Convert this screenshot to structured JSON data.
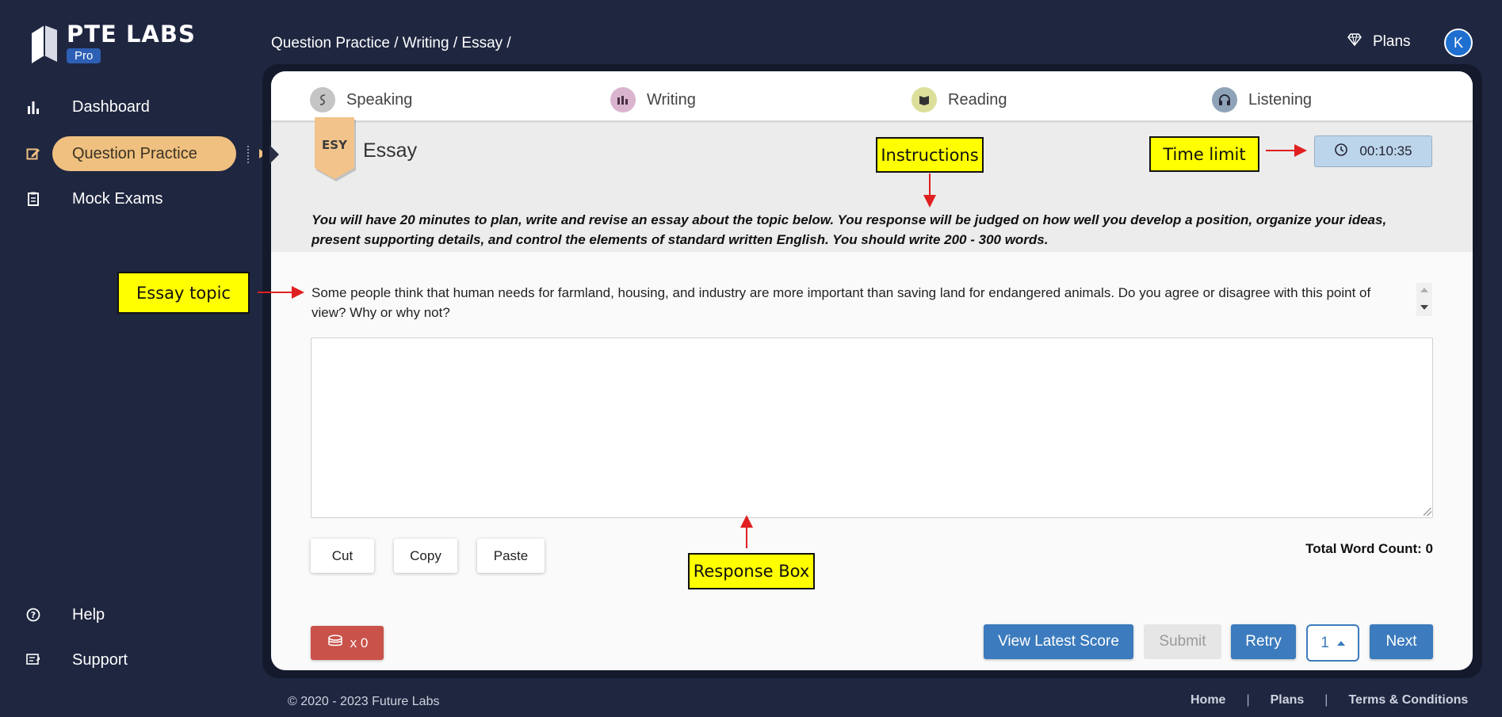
{
  "brand": {
    "title": "PTE LABS",
    "badge": "Pro"
  },
  "sidebar": {
    "items": [
      {
        "label": "Dashboard",
        "icon": "bar-chart-icon"
      },
      {
        "label": "Question Practice",
        "icon": "edit-icon",
        "active": true
      },
      {
        "label": "Mock Exams",
        "icon": "clipboard-icon"
      }
    ],
    "bottom_items": [
      {
        "label": "Help",
        "icon": "help-icon"
      },
      {
        "label": "Support",
        "icon": "support-icon"
      }
    ]
  },
  "header": {
    "breadcrumb": "Question Practice / Writing / Essay /",
    "plans_label": "Plans",
    "avatar_initial": "K"
  },
  "tabs": [
    {
      "label": "Speaking",
      "icon": "speaking-icon",
      "color": "#b9b9b9"
    },
    {
      "label": "Writing",
      "icon": "writing-icon",
      "color": "#d6a8c8"
    },
    {
      "label": "Reading",
      "icon": "reading-icon",
      "color": "#d6d98a"
    },
    {
      "label": "Listening",
      "icon": "headphones-icon",
      "color": "#8fa3b8"
    }
  ],
  "question": {
    "code": "ESY",
    "title": "Essay",
    "timer": "00:10:35",
    "instructions": "You will have 20 minutes to plan, write and revise an essay about the topic below. You response will be judged on how well you develop a position, organize your ideas, present supporting details, and control the elements of standard written English. You should write 200 - 300 words.",
    "topic": "Some people think that human needs for farmland, housing, and industry are more important than saving land for endangered animals. Do you agree or disagree with this point of view? Why or why not?",
    "response_value": "",
    "word_count_label": "Total Word Count: 0"
  },
  "annotations": {
    "instructions": "Instructions",
    "time_limit": "Time limit",
    "essay_topic": "Essay topic",
    "response_box": "Response Box"
  },
  "edit_buttons": {
    "cut": "Cut",
    "copy": "Copy",
    "paste": "Paste"
  },
  "actions": {
    "coins": "x 0",
    "view_latest_score": "View Latest Score",
    "submit": "Submit",
    "retry": "Retry",
    "page_number": "1",
    "next": "Next"
  },
  "footer": {
    "copyright": "© 2020 - 2023 Future Labs",
    "links": [
      "Home",
      "Plans",
      "Terms & Conditions"
    ],
    "separator": "|"
  },
  "colors": {
    "background": "#1f2640",
    "accent": "#f0c080",
    "primary_button": "#3c7bbd",
    "coin_button": "#c9524a",
    "annotation": "#ffff00",
    "annotation_arrow": "#e02020"
  }
}
